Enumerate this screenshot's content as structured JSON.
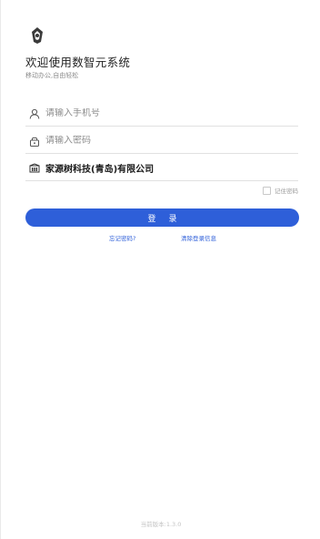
{
  "header": {
    "welcome": "欢迎使用数智元系统",
    "subtitle": "移动办公,自由轻松"
  },
  "form": {
    "phone_placeholder": "请输入手机号",
    "password_placeholder": "请输入密码",
    "company": "家源树科技(青岛)有限公司",
    "remember_label": "记住密码",
    "login_label": "登录"
  },
  "links": {
    "forgot": "忘记密码?",
    "clear": "清除登录信息"
  },
  "footer": {
    "version": "当前版本:1.3.0"
  },
  "icons": {
    "logo": "app-logo-icon",
    "phone": "user-icon",
    "password": "lock-icon",
    "company": "building-icon"
  },
  "colors": {
    "primary": "#2e5fd9"
  }
}
